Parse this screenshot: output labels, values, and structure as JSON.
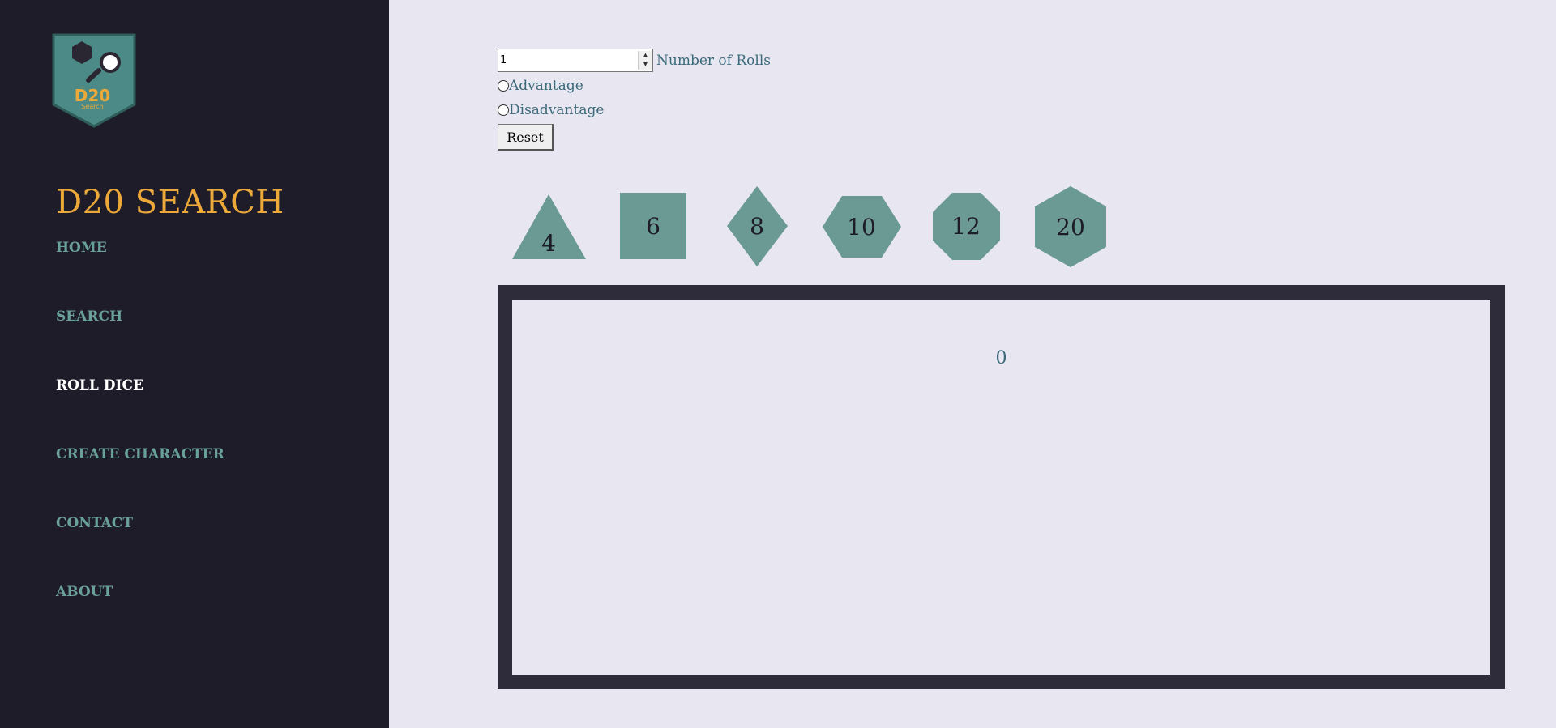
{
  "brand": {
    "title": "D20 SEARCH",
    "logo": {
      "icon": "d20-search-shield-logo",
      "text_main": "D20",
      "text_sub": "Search",
      "colors": {
        "shield": "#4b8a86",
        "shield_border": "#2f5d5a",
        "hexagon": "#2a2733",
        "lens": "#ffffff",
        "text": "#eca93a"
      }
    }
  },
  "nav": {
    "items": [
      {
        "label": "HOME",
        "active": false
      },
      {
        "label": "SEARCH",
        "active": false
      },
      {
        "label": "ROLL DICE",
        "active": true
      },
      {
        "label": "CREATE CHARACTER",
        "active": false
      },
      {
        "label": "CONTACT",
        "active": false
      },
      {
        "label": "ABOUT",
        "active": false
      }
    ]
  },
  "controls": {
    "rolls_value": "1",
    "rolls_label": "Number of Rolls",
    "advantage_label": "Advantage",
    "disadvantage_label": "Disadvantage",
    "reset_label": "Reset"
  },
  "dice": [
    {
      "label": "4",
      "shape": "triangle"
    },
    {
      "label": "6",
      "shape": "square"
    },
    {
      "label": "8",
      "shape": "diamond"
    },
    {
      "label": "10",
      "shape": "hexagon-wide"
    },
    {
      "label": "12",
      "shape": "octagon"
    },
    {
      "label": "20",
      "shape": "hexagon-tall"
    }
  ],
  "result": {
    "value": "0"
  },
  "colors": {
    "sidebar": "#1e1c28",
    "page_bg": "#e8e7f1",
    "brand": "#eca93a",
    "nav_text": "#6aa09a",
    "nav_active": "#ffffff",
    "die_fill": "#6b9a94",
    "result_border": "#2e2c3b",
    "text_blue": "#3b6a7a"
  }
}
